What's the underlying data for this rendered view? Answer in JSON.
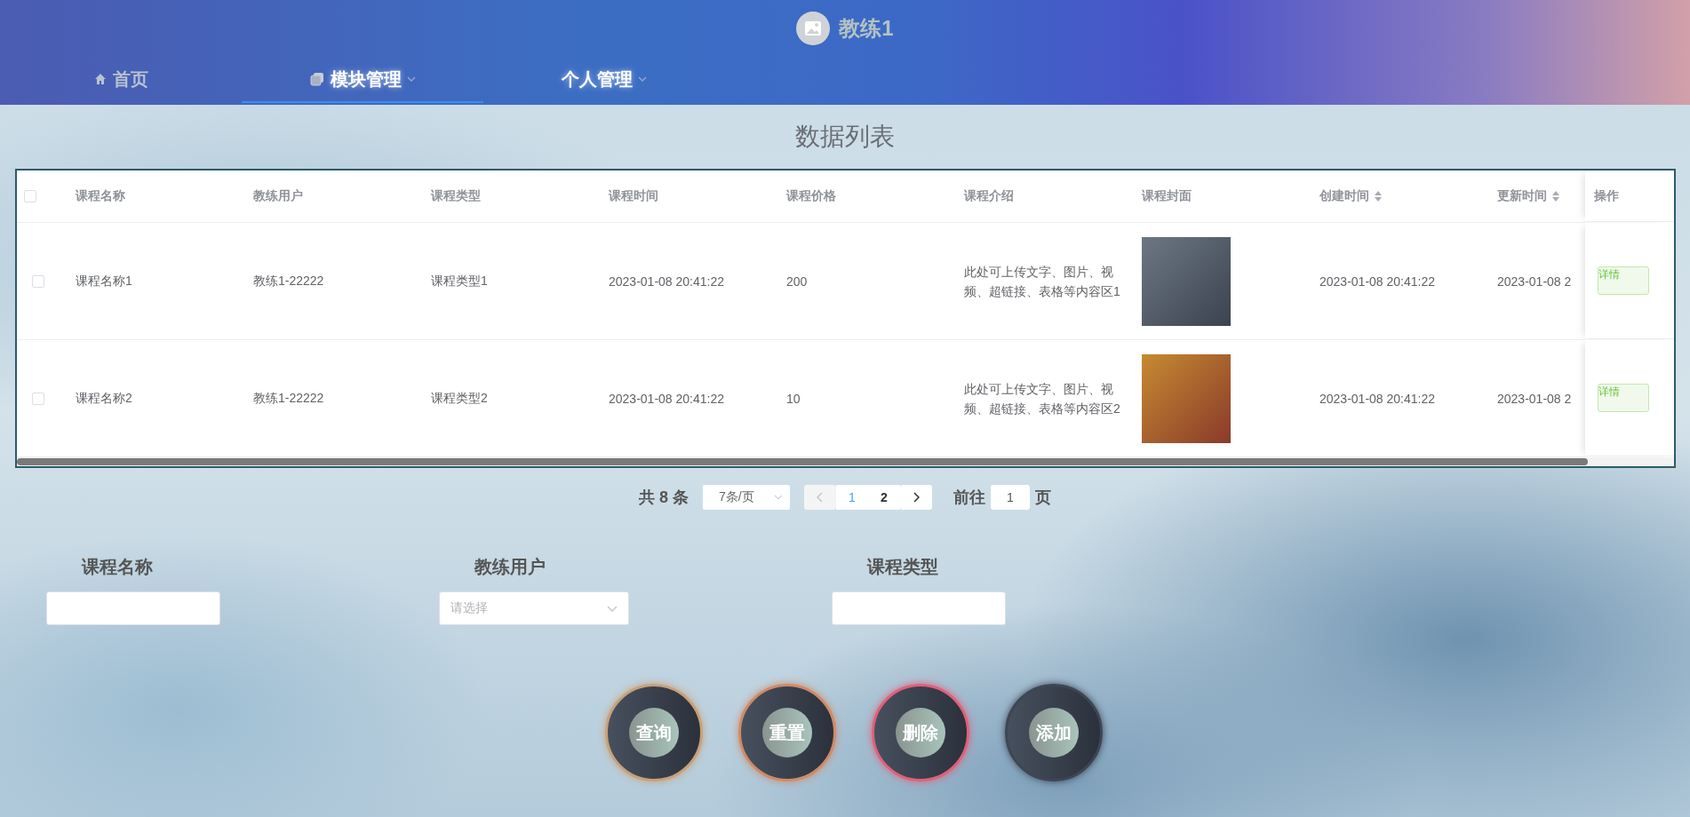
{
  "header": {
    "title": "教练1"
  },
  "nav": [
    {
      "label": "首页",
      "selected": false,
      "dropdown": false
    },
    {
      "label": "模块管理",
      "selected": true,
      "dropdown": true
    },
    {
      "label": "个人管理",
      "selected": false,
      "dropdown": true
    }
  ],
  "page_title": "数据列表",
  "table": {
    "select_all_checked": false,
    "columns": [
      {
        "label": "课程名称",
        "kind": "text",
        "sortable": false
      },
      {
        "label": "教练用户",
        "kind": "text",
        "sortable": false
      },
      {
        "label": "课程类型",
        "kind": "text",
        "sortable": false
      },
      {
        "label": "课程时间",
        "kind": "text",
        "sortable": false
      },
      {
        "label": "课程价格",
        "kind": "text",
        "sortable": false
      },
      {
        "label": "课程介绍",
        "kind": "text",
        "sortable": false
      },
      {
        "label": "课程封面",
        "kind": "photo",
        "sortable": false
      },
      {
        "label": "创建时间",
        "kind": "text",
        "sortable": true
      },
      {
        "label": "更新时间",
        "kind": "text",
        "sortable": true
      },
      {
        "label": "操作",
        "kind": "action",
        "sortable": false
      }
    ],
    "rows": [
      {
        "checked": false,
        "values": [
          "课程名称1",
          "教练1-22222",
          "课程类型1",
          "2023-01-08 20:41:22",
          "200",
          "此处可上传文字、图片、视频、超链接、表格等内容区1",
          "2023-01-08 20:41:22",
          "2023-01-08 2"
        ],
        "action": "详情"
      },
      {
        "checked": false,
        "values": [
          "课程名称2",
          "教练1-22222",
          "课程类型2",
          "2023-01-08 20:41:22",
          "10",
          "此处可上传文字、图片、视频、超链接、表格等内容区2",
          "2023-01-08 20:41:22",
          "2023-01-08 2"
        ],
        "action": "详情"
      }
    ]
  },
  "pagination": {
    "total": "共 8 条",
    "page_size": "7条/页",
    "prev_disabled": true,
    "next_disabled": false,
    "pages": [
      {
        "label": "1",
        "selected": true
      },
      {
        "label": "2",
        "selected": false
      }
    ],
    "goto_label": "前往",
    "goto_value": "1",
    "goto_suffix": "页"
  },
  "search_form": [
    {
      "label": "课程名称",
      "kind": "input"
    },
    {
      "label": "教练用户",
      "kind": "select",
      "placeholder": "请选择"
    },
    {
      "label": "课程类型",
      "kind": "input"
    }
  ],
  "buttons": [
    {
      "label": "查询",
      "color": "#c9a078"
    },
    {
      "label": "重置",
      "color": "#cf8a68"
    },
    {
      "label": "删除",
      "color": "#e0607a"
    },
    {
      "label": "添加",
      "color": "#3e4654"
    }
  ]
}
